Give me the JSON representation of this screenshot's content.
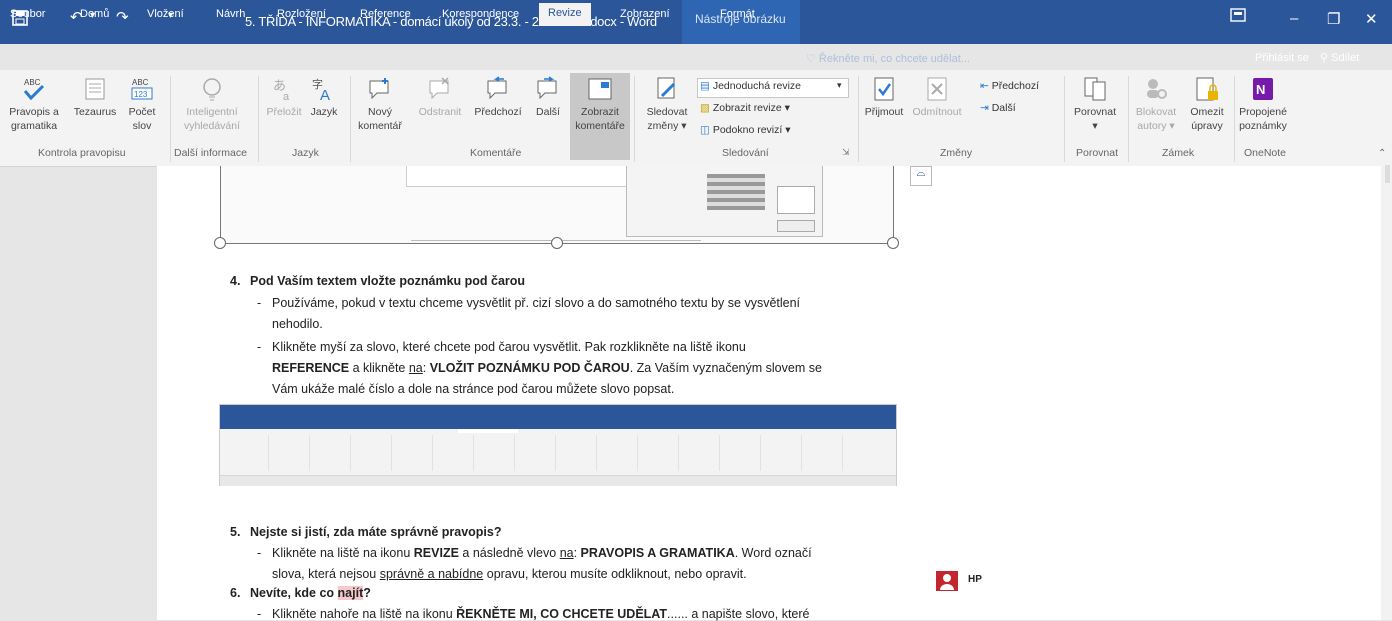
{
  "window": {
    "title": "5. TŘÍDA - INFORMATIKA - domácí úkoly od 23.3. - 27.3.2020.docx - Word",
    "contextual_tab_group": "Nástroje obrázku",
    "ribbon_display_icon": "ribbon-display-options-icon",
    "minimize": "–",
    "restore": "❐",
    "close": "✕"
  },
  "tabs": {
    "file": "Soubor",
    "home": "Domů",
    "insert": "Vložení",
    "design": "Návrh",
    "layout": "Rozložení",
    "references": "Reference",
    "mailings": "Korespondence",
    "review": "Revize",
    "view": "Zobrazení",
    "format": "Formát",
    "tell_me": "Řekněte mi, co chcete udělat...",
    "sign_in": "Přihlásit se",
    "share": "Sdílet"
  },
  "ribbon": {
    "spelling_line1": "Pravopis a",
    "spelling_line2": "gramatika",
    "thesaurus": "Tezaurus",
    "word_count_line1": "Počet",
    "word_count_line2": "slov",
    "smart_lookup_line1": "Inteligentní",
    "smart_lookup_line2": "vyhledávání",
    "translate": "Přeložit",
    "language": "Jazyk",
    "new_comment_line1": "Nový",
    "new_comment_line2": "komentář",
    "delete": "Odstranit",
    "previous": "Předchozí",
    "next": "Další",
    "show_comments_line1": "Zobrazit",
    "show_comments_line2": "komentáře",
    "track_changes_line1": "Sledovat",
    "track_changes_line2": "změny",
    "simple_markup": "Jednoduchá revize",
    "show_markup": "Zobrazit revize",
    "reviewing_pane": "Podokno revizí",
    "accept": "Přijmout",
    "reject": "Odmítnout",
    "changes_previous": "Předchozí",
    "changes_next": "Další",
    "compare": "Porovnat",
    "block_authors_line1": "Blokovat",
    "block_authors_line2": "autory",
    "restrict_editing_line1": "Omezit",
    "restrict_editing_line2": "úpravy",
    "linked_notes_line1": "Propojené",
    "linked_notes_line2": "poznámky",
    "groups": {
      "proofing": "Kontrola pravopisu",
      "insights": "Další informace",
      "language": "Jazyk",
      "comments": "Komentáře",
      "tracking": "Sledování",
      "changes": "Změny",
      "compare": "Porovnat",
      "protect": "Zámek",
      "onenote": "OneNote"
    }
  },
  "document": {
    "item4_num": "4.",
    "item4_title": "Pod Vaším textem vložte poznámku pod čarou",
    "item4_b1_line1": "Používáme, pokud v textu chceme vysvětlit př. cizí slovo a do samotného textu by se vysvětlení",
    "item4_b1_line2": "nehodilo.",
    "item4_b2_line1": "Klikněte myší za slovo, které chcete pod čarou vysvětlit. Pak rozklikněte na liště ikonu",
    "item4_b2_line2_bold1": "REFERENCE",
    "item4_b2_line2_t1": " a klikněte ",
    "item4_b2_line2_u": "na",
    "item4_b2_line2_t2": ": ",
    "item4_b2_line2_bold2": "VLOŽIT POZNÁMKU POD ČAROU",
    "item4_b2_line2_t3": ". Za Vaším vyznačeným slovem se",
    "item4_b2_line3": "Vám ukáže malé číslo a dole na stránce pod čarou můžete slovo popsat.",
    "item5_num": "5.",
    "item5_title": "Nejste si jistí, zda máte správně pravopis?",
    "item5_b1_t1": "Klikněte na liště na ikonu ",
    "item5_b1_bold1": "REVIZE",
    "item5_b1_t2": " a následně vlevo ",
    "item5_b1_u": "na",
    "item5_b1_t3": ": ",
    "item5_b1_bold2": "PRAVOPIS A GRAMATIKA",
    "item5_b1_t4": ". Word označí",
    "item5_b1_line2_t1": "slova, která nejsou ",
    "item5_b1_line2_u": "správně a nabídne",
    "item5_b1_line2_t2": " opravu, kterou musíte odkliknout, nebo opravit.",
    "item6_num": "6.",
    "item6_title_t1": "Nevíte, kde co ",
    "item6_title_hl": "najít",
    "item6_title_t2": "?",
    "item6_b1_t1": "Klikněte nahoře na liště na ikonu ",
    "item6_b1_bold": "ŘEKNĚTE MI, CO CHCETE UDĚLAT",
    "item6_b1_t2": "...... a napište slovo, které"
  },
  "comment": {
    "author": "HP"
  },
  "colors": {
    "word_blue": "#2b579a",
    "ribbon_bg": "#f3f3f3",
    "highlight": "#f8c9cc",
    "comment_icon": "#c4262e"
  }
}
